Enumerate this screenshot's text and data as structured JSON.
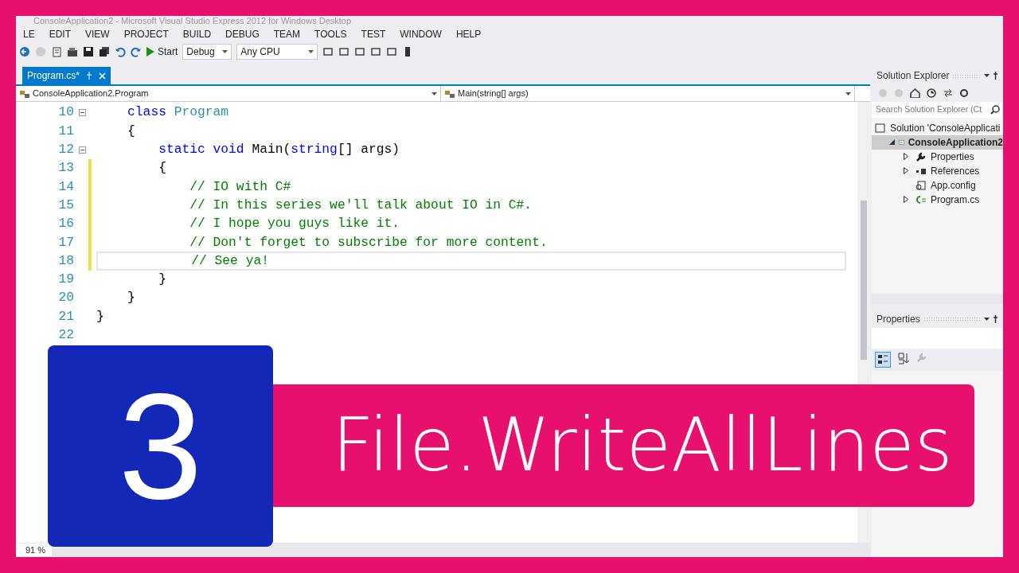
{
  "window": {
    "title": "ConsoleApplication2 - Microsoft Visual Studio Express 2012 for Windows Desktop"
  },
  "menu": [
    "LE",
    "EDIT",
    "VIEW",
    "PROJECT",
    "BUILD",
    "DEBUG",
    "TEAM",
    "TOOLS",
    "TEST",
    "WINDOW",
    "HELP"
  ],
  "toolbar": {
    "start": "Start",
    "configuration": "Debug",
    "platform": "Any CPU"
  },
  "tabs": [
    {
      "label": "Program.cs*",
      "selected": true
    }
  ],
  "navigation": {
    "type": "ConsoleApplication2.Program",
    "member": "Main(string[] args)"
  },
  "code_lines": [
    {
      "number": "10",
      "fold": true,
      "changed": false,
      "current": false,
      "tokens": [
        {
          "kind": "keyword",
          "text": "    class "
        },
        {
          "kind": "type",
          "text": "Program"
        }
      ]
    },
    {
      "number": "11",
      "fold": false,
      "changed": false,
      "current": false,
      "tokens": [
        {
          "kind": "plain",
          "text": "    {"
        }
      ]
    },
    {
      "number": "12",
      "fold": true,
      "changed": false,
      "current": false,
      "tokens": [
        {
          "kind": "keyword",
          "text": "        static void"
        },
        {
          "kind": "plain",
          "text": " Main("
        },
        {
          "kind": "keyword",
          "text": "string"
        },
        {
          "kind": "plain",
          "text": "[] args)"
        }
      ]
    },
    {
      "number": "13",
      "fold": false,
      "changed": true,
      "current": false,
      "tokens": [
        {
          "kind": "plain",
          "text": "        {"
        }
      ]
    },
    {
      "number": "14",
      "fold": false,
      "changed": true,
      "current": false,
      "tokens": [
        {
          "kind": "comment",
          "text": "            // IO with C#"
        }
      ]
    },
    {
      "number": "15",
      "fold": false,
      "changed": true,
      "current": false,
      "tokens": [
        {
          "kind": "comment",
          "text": "            // In this series we'll talk about IO in C#."
        }
      ]
    },
    {
      "number": "16",
      "fold": false,
      "changed": true,
      "current": false,
      "tokens": [
        {
          "kind": "comment",
          "text": "            // I hope you guys like it."
        }
      ]
    },
    {
      "number": "17",
      "fold": false,
      "changed": true,
      "current": false,
      "tokens": [
        {
          "kind": "comment",
          "text": "            // Don't forget to subscribe for more content."
        }
      ]
    },
    {
      "number": "18",
      "fold": false,
      "changed": true,
      "current": true,
      "tokens": [
        {
          "kind": "comment",
          "text": "            // See ya!"
        }
      ]
    },
    {
      "number": "19",
      "fold": false,
      "changed": false,
      "current": false,
      "tokens": [
        {
          "kind": "plain",
          "text": "        }"
        }
      ]
    },
    {
      "number": "20",
      "fold": false,
      "changed": false,
      "current": false,
      "tokens": [
        {
          "kind": "plain",
          "text": "    }"
        }
      ]
    },
    {
      "number": "21",
      "fold": false,
      "changed": false,
      "current": false,
      "tokens": [
        {
          "kind": "plain",
          "text": "}"
        }
      ]
    },
    {
      "number": "22",
      "fold": false,
      "changed": false,
      "current": false
    }
  ],
  "zoom": "91 %",
  "solution_explorer": {
    "title": "Solution Explorer",
    "search": {
      "placeholder": "Search Solution Explorer (Ct"
    },
    "tree": [
      {
        "label": "Solution 'ConsoleApplicati",
        "kind": "solution",
        "expanded": true,
        "selected": false,
        "children": [
          {
            "label": "ConsoleApplication2",
            "kind": "project",
            "expanded": true,
            "selected": true,
            "children": [
              {
                "label": "Properties",
                "kind": "properties",
                "expandable": true,
                "selected": false
              },
              {
                "label": "References",
                "kind": "references",
                "expandable": true,
                "selected": false
              },
              {
                "label": "App.config",
                "kind": "config",
                "expandable": false,
                "selected": false
              },
              {
                "label": "Program.cs",
                "kind": "csharp",
                "expandable": true,
                "selected": false
              }
            ]
          }
        ]
      }
    ]
  },
  "properties_panel": {
    "title": "Properties"
  },
  "overlay": {
    "number": "3",
    "title": "File.WriteAllLines"
  }
}
